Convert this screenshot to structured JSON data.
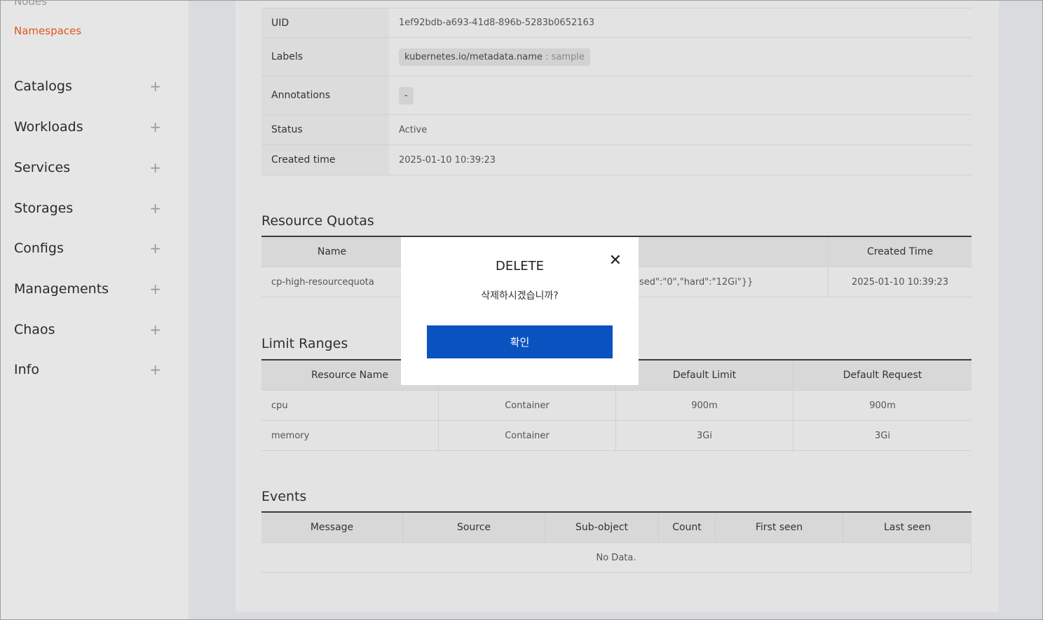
{
  "sidebar": {
    "sub_items": [
      "Nodes",
      "Namespaces"
    ],
    "items": [
      {
        "label": "Catalogs"
      },
      {
        "label": "Workloads"
      },
      {
        "label": "Services"
      },
      {
        "label": "Storages"
      },
      {
        "label": "Configs"
      },
      {
        "label": "Managements"
      },
      {
        "label": "Chaos"
      },
      {
        "label": "Info"
      }
    ],
    "expand_glyph": "+"
  },
  "details": {
    "uid_label": "UID",
    "uid_value": "1ef92bdb-a693-41d8-896b-5283b0652163",
    "labels_label": "Labels",
    "label_key": "kubernetes.io/metadata.name",
    "label_sep": " : ",
    "label_value": "sample",
    "annotations_label": "Annotations",
    "annotations_value": "-",
    "status_label": "Status",
    "status_value": "Active",
    "created_label": "Created time",
    "created_value": "2025-01-10 10:39:23"
  },
  "resource_quotas": {
    "title": "Resource Quotas",
    "headers": [
      "Name",
      "",
      "Created Time"
    ],
    "rows": [
      [
        "cp-high-resourcequota",
        "sed\":\"0\",\"hard\":\"12Gi\"}}",
        "2025-01-10 10:39:23"
      ]
    ]
  },
  "limit_ranges": {
    "title": "Limit Ranges",
    "headers": [
      "Resource Name",
      "",
      "Default Limit",
      "Default Request"
    ],
    "rows": [
      [
        "cpu",
        "Container",
        "900m",
        "900m"
      ],
      [
        "memory",
        "Container",
        "3Gi",
        "3Gi"
      ]
    ]
  },
  "events": {
    "title": "Events",
    "headers": [
      "Message",
      "Source",
      "Sub-object",
      "Count",
      "First seen",
      "Last seen"
    ],
    "empty_text": "No Data."
  },
  "modal": {
    "title": "DELETE",
    "message": "삭제하시겠습니까?",
    "confirm_label": "확인",
    "close_glyph": "✕"
  },
  "colors": {
    "accent": "#e0561c",
    "primary_button": "#0a52bf"
  }
}
